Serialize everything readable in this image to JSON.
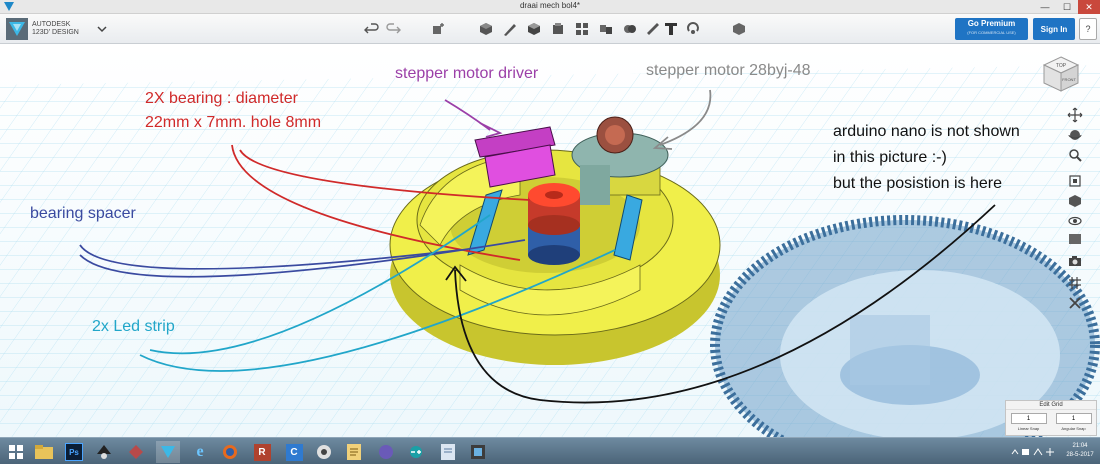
{
  "window": {
    "title": "draai mech bol4*",
    "minimize": "—",
    "maximize": "☐",
    "close": "✕"
  },
  "brand": {
    "line1": "AUTODESK",
    "line2": "123D' DESIGN",
    "menu_icon": "chevron-down-icon"
  },
  "toolbar": {
    "undo_icon": "undo-icon",
    "redo_icon": "redo-icon",
    "tools": [
      "transform-icon",
      "primitives-icon",
      "sketch-icon",
      "construct-icon",
      "modify-icon",
      "pattern-icon",
      "group-icon",
      "combine-icon",
      "measure-icon",
      "text-icon",
      "snap-icon",
      "material-icon"
    ],
    "go_premium": "Go Premium",
    "go_premium_sub": "(FOR COMMERCIAL USE)",
    "sign_in": "Sign In",
    "help": "?"
  },
  "viewcube": {
    "top": "TOP",
    "front": "FRONT"
  },
  "annotations": {
    "driver": "stepper motor driver",
    "motor": "stepper motor 28byj-48",
    "bearing_line1": "2X bearing : diameter",
    "bearing_line2": "22mm x 7mm. hole 8mm",
    "spacer": "bearing spacer",
    "led": "2x Led strip",
    "nano_line1": "arduino nano is not shown",
    "nano_line2": "in this picture :-)",
    "nano_line3": "but the posistion is here"
  },
  "colors": {
    "driver": "#9b3fa8",
    "motor": "#8a8a8a",
    "bearing": "#d02a2a",
    "spacer": "#3a4aa0",
    "led": "#21a6c9",
    "nano": "#111111",
    "model_yellow": "#f0ef4a",
    "gear_blue": "#4f88b8",
    "accent_blue": "#1f74c4"
  },
  "nav_icons": [
    "pan-icon",
    "orbit-icon",
    "zoom-icon",
    "fit-icon",
    "view-icon",
    "visibility-icon",
    "material-icon",
    "screenshot-icon",
    "grid-icon",
    "snap-icon"
  ],
  "edit_grid": {
    "title": "Edit Grid",
    "linear_value": "1",
    "angular_value": "1",
    "linear_label": "Linear Snap",
    "angular_label": "Angular Snap"
  },
  "taskbar": {
    "apps": [
      "windows-start-icon",
      "file-explorer-icon",
      "photoshop-icon",
      "inkscape-icon",
      "app-icon",
      "autodesk-123d-icon",
      "internet-explorer-icon",
      "firefox-icon",
      "revit-icon",
      "c-app-icon",
      "chrome-icon",
      "notepad-icon",
      "cura-icon",
      "arduino-icon",
      "document-icon",
      "slicer-icon"
    ],
    "photoshop_label": "Ps",
    "time": "21:04",
    "date": "28-5-2017"
  }
}
